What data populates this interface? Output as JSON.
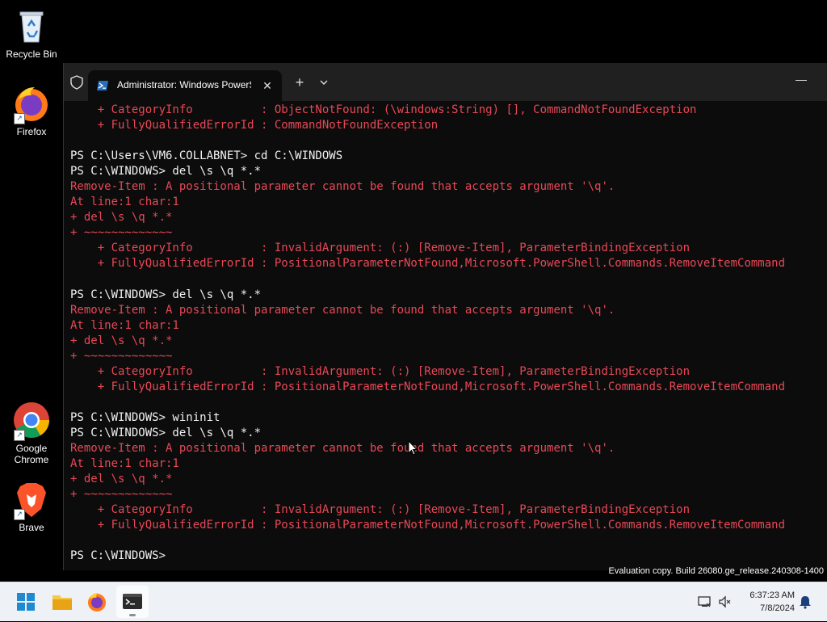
{
  "desktop": {
    "icons": [
      {
        "label": "Recycle Bin",
        "icon": "recycle-bin-icon"
      },
      {
        "label": "Firefox",
        "icon": "firefox-icon"
      },
      {
        "label": "Google Chrome",
        "icon": "chrome-icon"
      },
      {
        "label": "Brave",
        "icon": "brave-icon"
      }
    ],
    "watermark": "Evaluation copy. Build 26080.ge_release.240308-1400"
  },
  "terminal": {
    "tab_title": "Administrator: Windows PowerShell",
    "lines": [
      {
        "text": "    + CategoryInfo          : ObjectNotFound: (\\windows:String) [], CommandNotFoundException",
        "type": "err"
      },
      {
        "text": "    + FullyQualifiedErrorId : CommandNotFoundException",
        "type": "err"
      },
      {
        "text": "",
        "type": "out"
      },
      {
        "text": "PS C:\\Users\\VM6.COLLABNET> cd C:\\WINDOWS",
        "type": "cmd"
      },
      {
        "text": "PS C:\\WINDOWS> del \\s \\q *.*",
        "type": "cmd"
      },
      {
        "text": "Remove-Item : A positional parameter cannot be found that accepts argument '\\q'.",
        "type": "err"
      },
      {
        "text": "At line:1 char:1",
        "type": "err"
      },
      {
        "text": "+ del \\s \\q *.*",
        "type": "err"
      },
      {
        "text": "+ ~~~~~~~~~~~~~",
        "type": "err"
      },
      {
        "text": "    + CategoryInfo          : InvalidArgument: (:) [Remove-Item], ParameterBindingException",
        "type": "err"
      },
      {
        "text": "    + FullyQualifiedErrorId : PositionalParameterNotFound,Microsoft.PowerShell.Commands.RemoveItemCommand",
        "type": "err"
      },
      {
        "text": "",
        "type": "out"
      },
      {
        "text": "PS C:\\WINDOWS> del \\s \\q *.*",
        "type": "cmd"
      },
      {
        "text": "Remove-Item : A positional parameter cannot be found that accepts argument '\\q'.",
        "type": "err"
      },
      {
        "text": "At line:1 char:1",
        "type": "err"
      },
      {
        "text": "+ del \\s \\q *.*",
        "type": "err"
      },
      {
        "text": "+ ~~~~~~~~~~~~~",
        "type": "err"
      },
      {
        "text": "    + CategoryInfo          : InvalidArgument: (:) [Remove-Item], ParameterBindingException",
        "type": "err"
      },
      {
        "text": "    + FullyQualifiedErrorId : PositionalParameterNotFound,Microsoft.PowerShell.Commands.RemoveItemCommand",
        "type": "err"
      },
      {
        "text": "",
        "type": "out"
      },
      {
        "text": "PS C:\\WINDOWS> wininit",
        "type": "cmd"
      },
      {
        "text": "PS C:\\WINDOWS> del \\s \\q *.*",
        "type": "cmd"
      },
      {
        "text": "Remove-Item : A positional parameter cannot be found that accepts argument '\\q'.",
        "type": "err"
      },
      {
        "text": "At line:1 char:1",
        "type": "err"
      },
      {
        "text": "+ del \\s \\q *.*",
        "type": "err"
      },
      {
        "text": "+ ~~~~~~~~~~~~~",
        "type": "err"
      },
      {
        "text": "    + CategoryInfo          : InvalidArgument: (:) [Remove-Item], ParameterBindingException",
        "type": "err"
      },
      {
        "text": "    + FullyQualifiedErrorId : PositionalParameterNotFound,Microsoft.PowerShell.Commands.RemoveItemCommand",
        "type": "err"
      },
      {
        "text": "",
        "type": "out"
      },
      {
        "text": "PS C:\\WINDOWS> ",
        "type": "cmd"
      }
    ]
  },
  "taskbar": {
    "apps": [
      "start-icon",
      "file-explorer-icon",
      "firefox-icon",
      "terminal-icon"
    ],
    "clock_time": "6:37:23 AM",
    "clock_date": "7/8/2024"
  },
  "colors": {
    "error": "#e74856",
    "console_bg": "#0c0c0c",
    "taskbar_bg": "#eef1f6"
  }
}
